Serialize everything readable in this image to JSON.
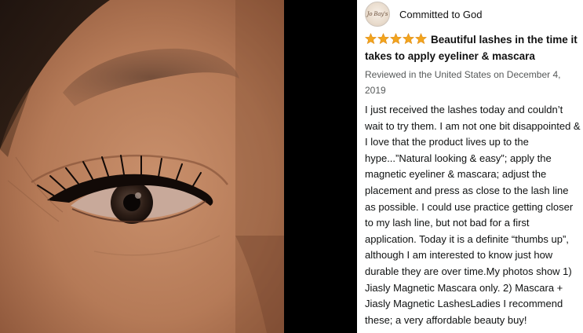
{
  "review": {
    "reviewer_name": "Committed to God",
    "avatar_text": "Jo Bay's",
    "rating": 5,
    "star_color": "#F2A51F",
    "title": "Beautiful lashes in the time it takes to apply eyeliner & mascara",
    "meta": "Reviewed in the United States on December 4, 2019",
    "body": "I just received the lashes today and couldn’t wait to try them. I am not one bit disappointed & I love that the product lives up to the hype...”Natural looking & easy”; apply the magnetic eyeliner & mascara; adjust the placement and press as close to the lash line as possible. I could use practice getting closer to my lash line, but not bad for a first application. Today it is a definite “thumbs up”, although I am interested to know just how durable they are over time.My photos show 1) Jiasly Magnetic Mascara only. 2) Mascara + Jiasly Magnetic LashesLadies I recommend these; a very affordable beauty buy!"
  },
  "photo": {
    "icon": "customer-eye-photo"
  }
}
